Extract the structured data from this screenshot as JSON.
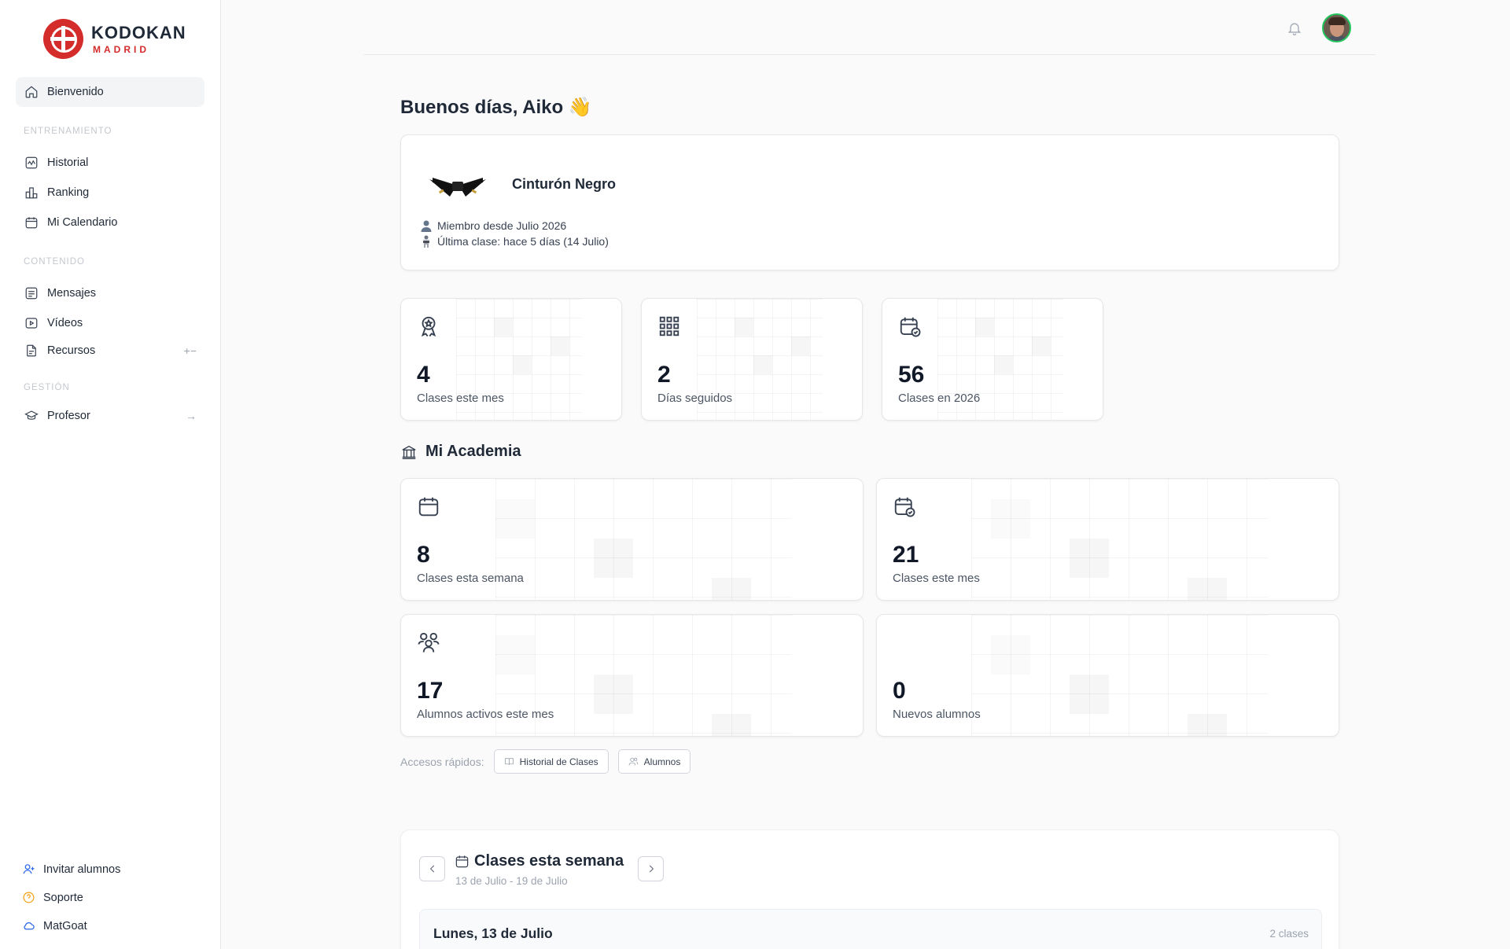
{
  "brand": {
    "name": "KODOKAN",
    "sub": "MADRID",
    "color": "#d42b2b"
  },
  "sidebar": {
    "active": {
      "label": "Bienvenido",
      "icon": "home-icon"
    },
    "sections": [
      {
        "label": "ENTRENAMIENTO",
        "items": [
          {
            "label": "Historial",
            "icon": "activity-icon"
          },
          {
            "label": "Ranking",
            "icon": "ranking-icon"
          },
          {
            "label": "Mi Calendario",
            "icon": "calendar-icon"
          }
        ]
      },
      {
        "label": "CONTENIDO",
        "items": [
          {
            "label": "Mensajes",
            "icon": "message-icon"
          },
          {
            "label": "Vídeos",
            "icon": "video-icon"
          },
          {
            "label": "Recursos",
            "icon": "file-icon",
            "trail": "+−"
          }
        ]
      },
      {
        "label": "GESTIÓN",
        "items": [
          {
            "label": "Profesor",
            "icon": "graduation-cap-icon",
            "trail": "→"
          }
        ]
      }
    ],
    "footer": [
      {
        "label": "Invitar alumnos",
        "icon": "user-plus-icon",
        "color": "#2563eb"
      },
      {
        "label": "Soporte",
        "icon": "help-circle-icon",
        "color": "#f59e0b"
      },
      {
        "label": "MatGoat",
        "icon": "cloud-icon",
        "color": "#2563eb"
      }
    ]
  },
  "header": {
    "notifications_icon": "bell-icon",
    "avatar": "user-avatar",
    "avatar_ring_color": "#22c55e"
  },
  "greeting": "Buenos días, Aiko 👋",
  "belt": {
    "title": "Cinturón Negro",
    "member_since": "Miembro desde Julio 2026",
    "last_class": "Última clase: hace 5 días (14 Julio)"
  },
  "personal_stats": [
    {
      "value": "4",
      "label": "Clases este mes",
      "icon": "award-icon"
    },
    {
      "value": "2",
      "label": "Días seguidos",
      "icon": "grid-icon"
    },
    {
      "value": "56",
      "label": "Clases en 2026",
      "icon": "calendar-check-icon"
    }
  ],
  "academy": {
    "title": "Mi Academia",
    "icon": "building-icon",
    "stats": [
      {
        "value": "8",
        "label": "Clases esta semana",
        "icon": "calendar-icon"
      },
      {
        "value": "21",
        "label": "Clases este mes",
        "icon": "calendar-check-icon"
      },
      {
        "value": "17",
        "label": "Alumnos activos este mes",
        "icon": "users-icon"
      },
      {
        "value": "0",
        "label": "Nuevos alumnos",
        "icon": ""
      }
    ]
  },
  "quick_access": {
    "label": "Accesos rápidos:",
    "links": [
      {
        "label": "Historial de Clases",
        "icon": "book-icon"
      },
      {
        "label": "Alumnos",
        "icon": "users-icon"
      }
    ]
  },
  "week": {
    "title": "Clases esta semana",
    "range": "13 de Julio - 19 de Julio",
    "day": {
      "title": "Lunes, 13 de Julio",
      "count": "2 clases"
    }
  }
}
